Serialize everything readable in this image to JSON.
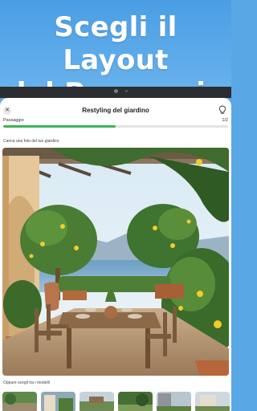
{
  "hero": {
    "title": "Scegli il Layout\ndel Paesaggio"
  },
  "app": {
    "title": "Restyling del giardino",
    "close_icon": "close-icon",
    "tip_icon": "lightbulb-icon"
  },
  "progress": {
    "label": "Passaggio",
    "count": "1/2",
    "fraction": 0.5,
    "color": "#3cb455"
  },
  "photo_section": {
    "label": "Carica una foto del tuo giardino"
  },
  "models_section": {
    "label": "Oppure scegli tra i modelli"
  },
  "colors": {
    "hero_bg": "#4b9ee4",
    "device_frame": "#2b2d31"
  }
}
